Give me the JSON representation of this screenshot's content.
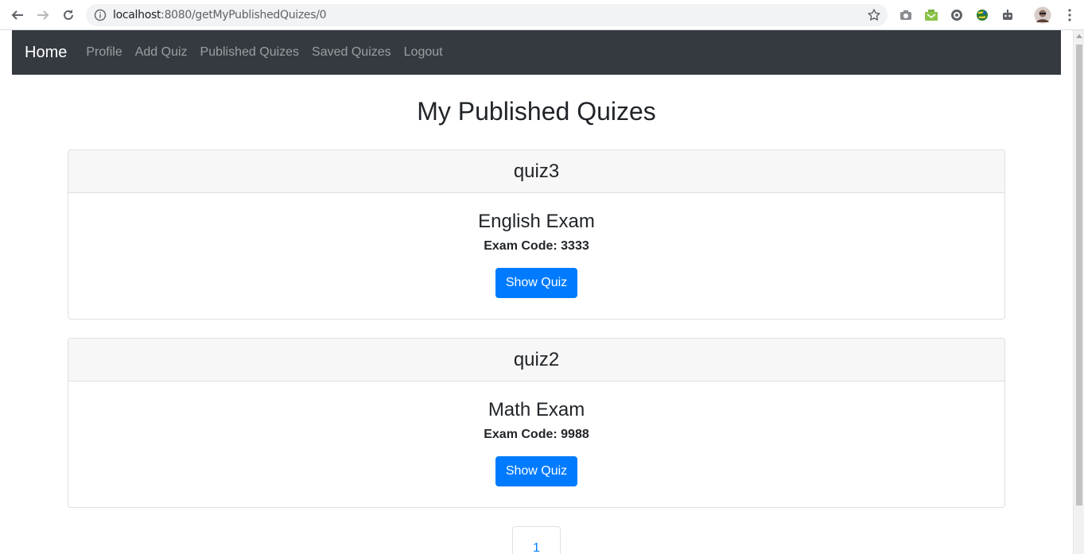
{
  "browser": {
    "url_host": "localhost",
    "url_port_path": ":8080/getMyPublishedQuizes/0",
    "icons": [
      "back-arrow-icon",
      "forward-arrow-icon",
      "reload-icon",
      "info-icon",
      "star-icon",
      "camera-icon",
      "inbox-icon",
      "extension-icon",
      "globe-icon",
      "robot-icon",
      "avatar",
      "more-menu-icon"
    ]
  },
  "navbar": {
    "brand": "Home",
    "links": [
      "Profile",
      "Add Quiz",
      "Published Quizes",
      "Saved Quizes",
      "Logout"
    ]
  },
  "page": {
    "title": "My Published Quizes"
  },
  "quizzes": [
    {
      "name": "quiz3",
      "exam_title": "English Exam",
      "exam_code": "Exam Code: 3333",
      "button": "Show Quiz"
    },
    {
      "name": "quiz2",
      "exam_title": "Math Exam",
      "exam_code": "Exam Code: 9988",
      "button": "Show Quiz"
    }
  ],
  "pagination": {
    "current_page": "1"
  },
  "colors": {
    "navbar_bg": "#343a40",
    "primary": "#007bff",
    "card_header_bg": "#f7f7f7"
  }
}
